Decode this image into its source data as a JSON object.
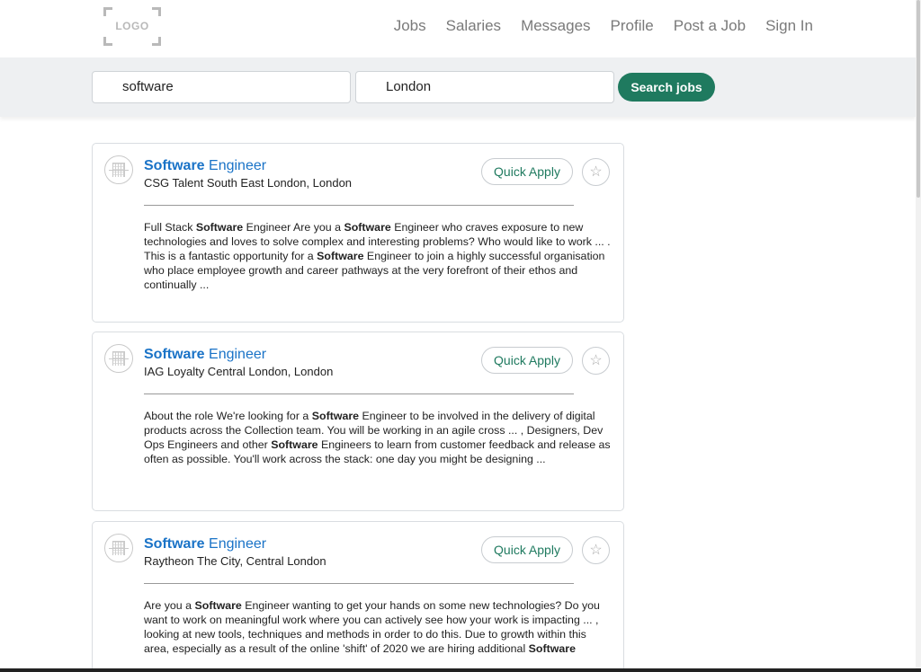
{
  "header": {
    "logo_text": "LOGO",
    "nav": [
      "Jobs",
      "Salaries",
      "Messages",
      "Profile",
      "Post a Job",
      "Sign In"
    ]
  },
  "search": {
    "what_value": "software",
    "where_value": "London",
    "button_label": "Search jobs"
  },
  "jobs": [
    {
      "title_bold": "Software",
      "title_rest": " Engineer",
      "company": "CSG Talent South East London, London",
      "quick_apply": "Quick Apply",
      "star": "☆",
      "description": [
        {
          "t": "Full Stack "
        },
        {
          "b": "Software"
        },
        {
          "t": " Engineer Are you a "
        },
        {
          "b": "Software"
        },
        {
          "t": " Engineer who craves exposure to new technologies and loves to solve complex and interesting problems? Who would like to work ... . This is a fantastic opportunity for a "
        },
        {
          "b": "Software"
        },
        {
          "t": " Engineer to join a highly successful organisation who place employee growth and career pathways at the very forefront of their ethos and continually ..."
        }
      ]
    },
    {
      "title_bold": "Software",
      "title_rest": " Engineer",
      "company": "IAG Loyalty Central London, London",
      "quick_apply": "Quick Apply",
      "star": "☆",
      "description": [
        {
          "t": "About the role We're looking for a "
        },
        {
          "b": "Software"
        },
        {
          "t": " Engineer to be involved in the delivery of digital products across the Collection team. You will be working in an agile cross ... , Designers, Dev Ops Engineers and other "
        },
        {
          "b": "Software"
        },
        {
          "t": " Engineers to learn from customer feedback and release as often as possible. You'll work across the stack: one day you might be designing ..."
        }
      ]
    },
    {
      "title_bold": "Software",
      "title_rest": " Engineer",
      "company": "Raytheon The City, Central London",
      "quick_apply": "Quick Apply",
      "star": "☆",
      "description": [
        {
          "t": "Are you a "
        },
        {
          "b": "Software"
        },
        {
          "t": " Engineer wanting to get your hands on some new technologies? Do you want to work on meaningful work where you can actively see how your work is impacting ... , looking at new tools, techniques and methods in order to do this. Due to growth within this area, especially as a result of the online 'shift' of 2020 we are hiring additional "
        },
        {
          "b": "Software"
        }
      ]
    }
  ]
}
